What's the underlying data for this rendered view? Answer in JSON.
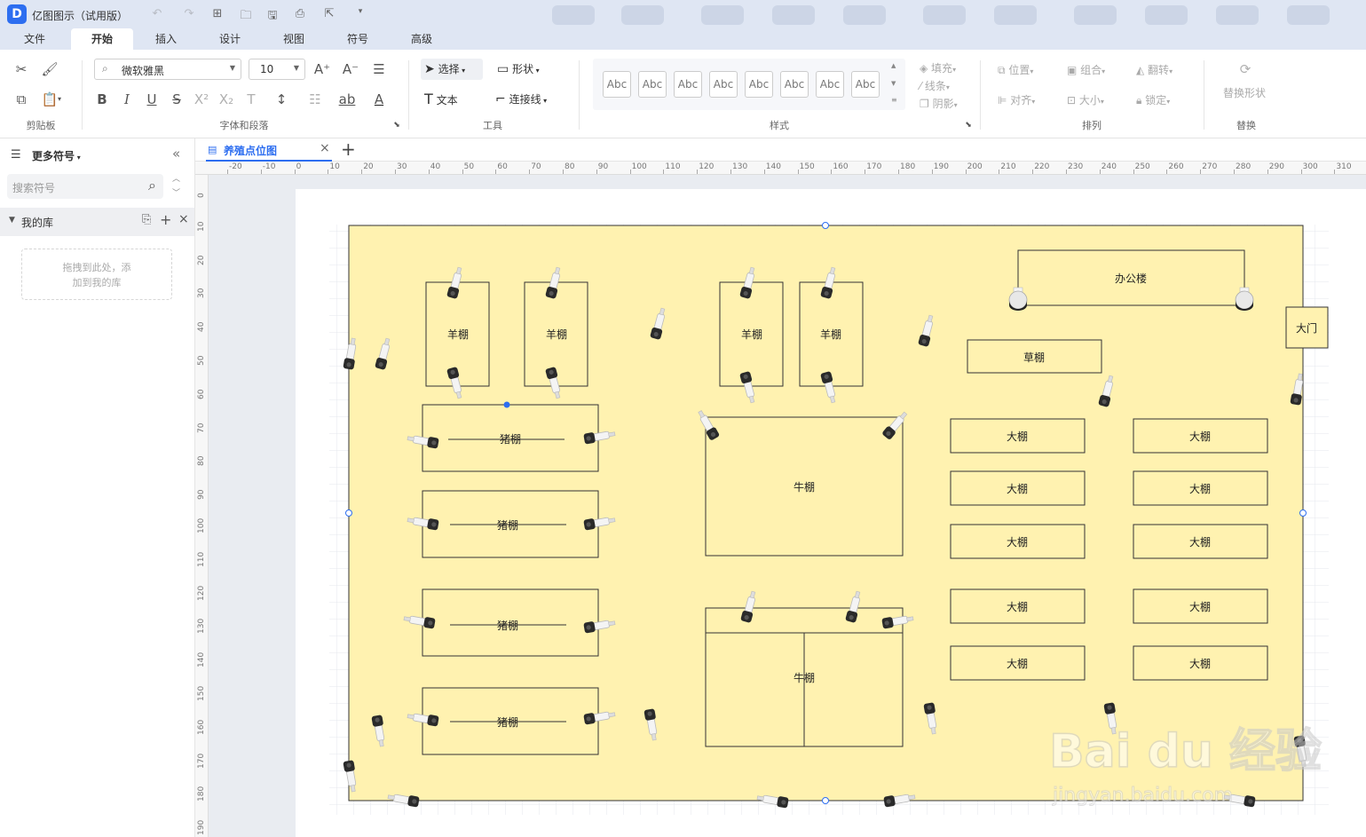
{
  "app": {
    "title": "亿图图示（试用版）",
    "logo_letter": "D"
  },
  "menu_tabs": [
    "文件",
    "开始",
    "插入",
    "设计",
    "视图",
    "符号",
    "高级"
  ],
  "ribbon": {
    "clipboard_label": "剪贴板",
    "font_label": "字体和段落",
    "tools_label": "工具",
    "style_label": "样式",
    "arrange_label": "排列",
    "replace_label": "替换",
    "font_family": "微软雅黑",
    "font_size": "10",
    "select_label": "选择",
    "shape_label": "形状",
    "text_label": "文本",
    "connector_label": "连接线",
    "style_sample": "Abc",
    "fill_label": "填充",
    "line_label": "线条",
    "shadow_label": "阴影",
    "position_label": "位置",
    "group_label": "组合",
    "rotate_label": "翻转",
    "align_label": "对齐",
    "size_label": "大小",
    "lock_label": "锁定",
    "replace_shape_label": "替换形状"
  },
  "left_panel": {
    "more_symbols": "更多符号",
    "search_placeholder": "搜索符号",
    "my_library": "我的库",
    "drop_hint_1": "拖拽到此处，添",
    "drop_hint_2": "加到我的库"
  },
  "doc_tab": {
    "name": "养殖点位图"
  },
  "ruler": {
    "h_ticks": [
      "-20",
      "-10",
      "0",
      "10",
      "20",
      "30",
      "40",
      "50",
      "60",
      "70",
      "80",
      "90",
      "100",
      "110",
      "120",
      "130",
      "140",
      "150",
      "160",
      "170",
      "180",
      "190",
      "200",
      "210",
      "220",
      "230",
      "240",
      "250",
      "260",
      "270",
      "280",
      "290",
      "300",
      "310"
    ],
    "v_ticks": [
      "0",
      "10",
      "20",
      "30",
      "40",
      "50",
      "60",
      "70",
      "80",
      "90",
      "100",
      "110",
      "120",
      "130",
      "140",
      "150",
      "160",
      "170",
      "180",
      "190"
    ]
  },
  "diagram": {
    "sheep": "羊棚",
    "pig": "猪棚",
    "cattle": "牛棚",
    "office": "办公楼",
    "grass": "草棚",
    "greenhouse": "大棚",
    "gate": "大门"
  },
  "watermark": {
    "brand": "Bai du 经验",
    "url": "jingyan.baidu.com"
  },
  "colors": {
    "accent": "#2d6ef0",
    "floor": "#fff2b0",
    "titlebar": "#dfe6f3"
  }
}
